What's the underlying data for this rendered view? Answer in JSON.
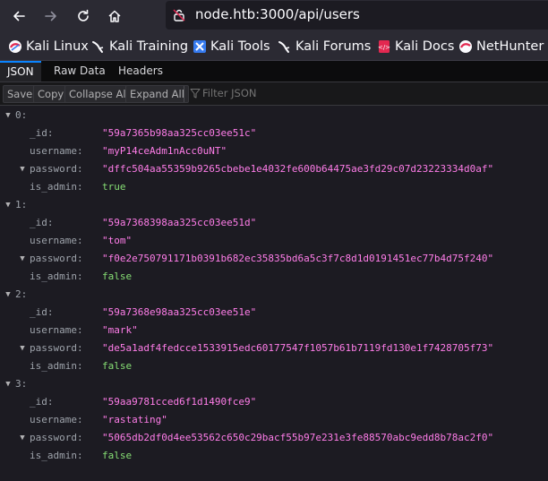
{
  "browser": {
    "url": "node.htb:3000/api/users",
    "icons": {
      "back": "arrow-left-icon",
      "forward": "arrow-right-icon",
      "reload": "reload-icon",
      "home": "home-icon",
      "site": "page-info-icon"
    }
  },
  "bookmarks": [
    {
      "label": "Kali Linux",
      "icon": "kali-icon"
    },
    {
      "label": "Kali Training",
      "icon": "kali-training-icon"
    },
    {
      "label": "Kali Tools",
      "icon": "kali-tools-icon"
    },
    {
      "label": "Kali Forums",
      "icon": "kali-forums-icon"
    },
    {
      "label": "Kali Docs",
      "icon": "kali-docs-icon"
    },
    {
      "label": "NetHunter",
      "icon": "nethunter-icon"
    }
  ],
  "viewer": {
    "tabs": [
      "JSON",
      "Raw Data",
      "Headers"
    ],
    "active_tab": "JSON",
    "toolbar": {
      "save": "Save",
      "copy": "Copy",
      "collapse_all": "Collapse All",
      "expand_all": "Expand All",
      "filter_placeholder": "Filter JSON"
    }
  },
  "users": [
    {
      "index": "0:",
      "_id": "\"59a7365b98aa325cc03ee51c\"",
      "username": "\"myP14ceAdm1nAcc0uNT\"",
      "password": "\"dffc504aa55359b9265cbebe1e4032fe600b64475ae3fd29c07d23223334d0af\"",
      "is_admin": "true"
    },
    {
      "index": "1:",
      "_id": "\"59a7368398aa325cc03ee51d\"",
      "username": "\"tom\"",
      "password": "\"f0e2e750791171b0391b682ec35835bd6a5c3f7c8d1d0191451ec77b4d75f240\"",
      "is_admin": "false"
    },
    {
      "index": "2:",
      "_id": "\"59a7368e98aa325cc03ee51e\"",
      "username": "\"mark\"",
      "password": "\"de5a1adf4fedcce1533915edc60177547f1057b61b7119fd130e1f7428705f73\"",
      "is_admin": "false"
    },
    {
      "index": "3:",
      "_id": "\"59aa9781cced6f1d1490fce9\"",
      "username": "\"rastating\"",
      "password": "\"5065db2df0d4ee53562c650c29bacf55b97e231e3fe88570abc9edd8b78ac2f0\"",
      "is_admin": "false"
    }
  ],
  "keys": {
    "id": "_id:",
    "username": "username:",
    "password": "password:",
    "is_admin": "is_admin:"
  }
}
